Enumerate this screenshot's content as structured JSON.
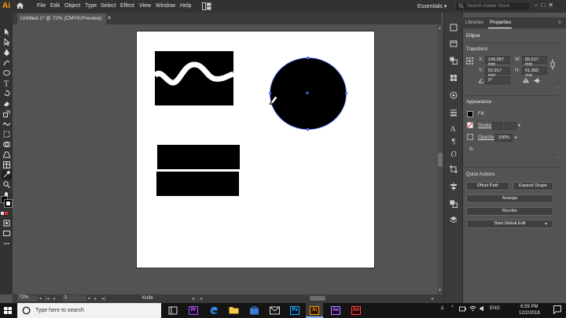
{
  "app": {
    "logo": "Ai",
    "colors": {
      "accent": "#ff9a00",
      "canvas": "#535353",
      "chrome": "#323232"
    }
  },
  "menu": {
    "items": [
      "File",
      "Edit",
      "Object",
      "Type",
      "Select",
      "Effect",
      "View",
      "Window",
      "Help"
    ],
    "workspace": "Essentials ▾",
    "search_placeholder": "Search Adobe Stock",
    "window_controls": "–□✕"
  },
  "document": {
    "tab_title": "Untitled-1* @ 72% (CMYK/Preview)",
    "close_glyph": "✕"
  },
  "toolbar": {
    "icons": [
      "selection-icon",
      "direct-selection-icon",
      "pen-icon",
      "curvature-icon",
      "ellipse-icon",
      "type-icon",
      "rotate-icon",
      "eraser-icon",
      "scale-icon",
      "warp-icon",
      "free-transform-icon",
      "shape-builder-icon",
      "perspective-icon",
      "eyedropper-icon",
      "hand-icon",
      "zoom-icon",
      "fill-stroke-icon",
      "draw-mode-icon",
      "screen-mode-icon",
      "edit-toolbar-icon"
    ]
  },
  "status": {
    "zoom": "72%",
    "artboard_num": "1",
    "tool_name": "Knife"
  },
  "panel": {
    "tabs": [
      "Libraries",
      "Properties"
    ],
    "active_tab": "Properties",
    "object_type": "Ellipse",
    "transform": {
      "title": "Transform",
      "x_label": "X:",
      "x": "145.687 mm",
      "y_label": "Y:",
      "y": "52.917 mm",
      "w_label": "W:",
      "w": "65.617 mm",
      "h_label": "H:",
      "h": "61.383 mm",
      "angle": "0°"
    },
    "appearance": {
      "title": "Appearance",
      "fill_label": "Fill",
      "stroke_label": "Stroke",
      "opacity_label": "Opacity",
      "opacity": "100%",
      "fx": "fx."
    },
    "quick_actions": {
      "title": "Quick Actions",
      "offset_path": "Offset Path",
      "expand_shape": "Expand Shape",
      "arrange": "Arrange",
      "recolor": "Recolor",
      "start_global_edit": "Start Global Edit"
    }
  },
  "taskbar": {
    "search_placeholder": "Type here to search",
    "apps": [
      "Pr",
      "Ps",
      "Ai",
      "Ae",
      "An"
    ],
    "language": "ENG",
    "time": "6:59 PM",
    "date": "12/2/2018"
  }
}
